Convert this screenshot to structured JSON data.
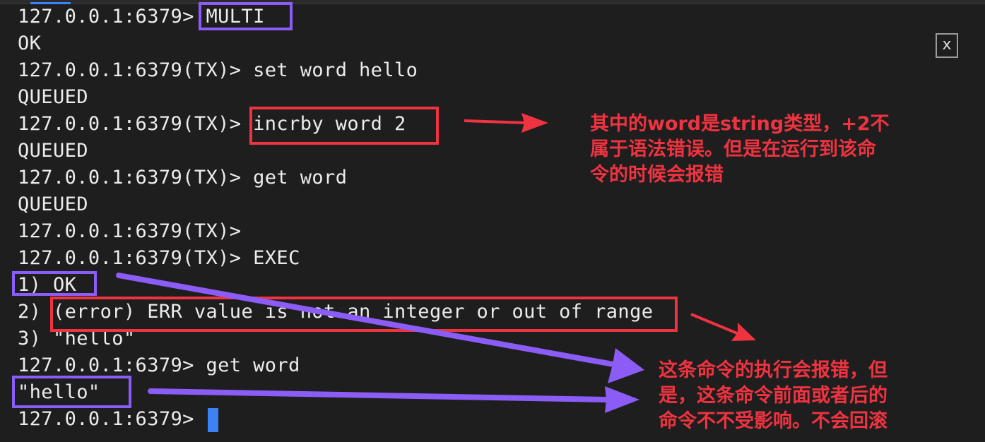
{
  "terminal": {
    "lines": [
      "127.0.0.1:6379> MULTI",
      "OK",
      "127.0.0.1:6379(TX)> set word hello",
      "QUEUED",
      "127.0.0.1:6379(TX)> incrby word 2",
      "QUEUED",
      "127.0.0.1:6379(TX)> get word",
      "QUEUED",
      "127.0.0.1:6379(TX)>",
      "127.0.0.1:6379(TX)> EXEC",
      "1) OK",
      "2) (error) ERR value is not an integer or out of range",
      "3) \"hello\"",
      "127.0.0.1:6379> get word",
      "\"hello\"",
      "127.0.0.1:6379> "
    ]
  },
  "close_button": {
    "label": "x",
    "icon": "close-icon"
  },
  "annotations": {
    "note_syntax": "其中的word是string类型，+2不\n属于语法错误。但是在运行到该命\n令的时候会报错",
    "note_no_rollback": "这条命令的执行会报错，但\n是，这条命令前面或者后的\n命令不不受影响。不会回滚"
  },
  "colors": {
    "background": "#1e1e1e",
    "text": "#ececec",
    "accent_red": "#ef3340",
    "accent_purple": "#8b5cf6",
    "cursor": "#3b82f6"
  }
}
